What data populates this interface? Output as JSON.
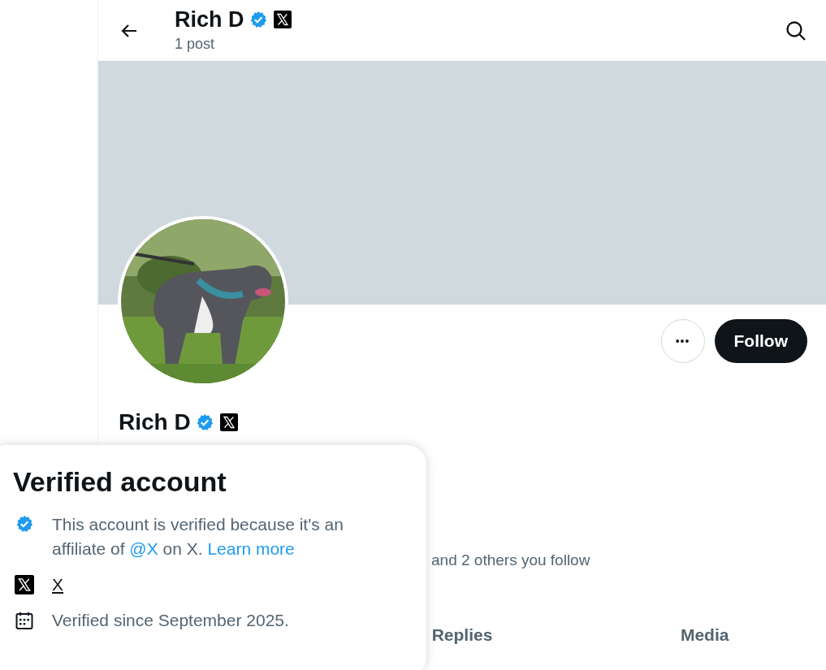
{
  "header": {
    "name": "Rich D",
    "post_count": "1 post"
  },
  "profile": {
    "name": "Rich D",
    "verified": true,
    "affiliate_badge": true,
    "more_button": "•••",
    "follow_button": "Follow",
    "followers_note": "and 2 others you follow"
  },
  "tabs": [
    {
      "label": "Replies",
      "selected": false
    },
    {
      "label": "Media",
      "selected": false
    }
  ],
  "popover": {
    "title": "Verified account",
    "rows": [
      {
        "kind": "verified",
        "parts": [
          {
            "kind": "text",
            "text": "This account is verified because it's an affiliate of "
          },
          {
            "kind": "link",
            "text": "@X"
          },
          {
            "kind": "text",
            "text": " on X. "
          },
          {
            "kind": "link",
            "text": "Learn more"
          }
        ]
      },
      {
        "kind": "affiliate",
        "parts": [
          {
            "kind": "underlined",
            "text": "X"
          }
        ]
      },
      {
        "kind": "calendar",
        "parts": [
          {
            "kind": "text",
            "text": "Verified since September 2025."
          }
        ]
      }
    ]
  }
}
